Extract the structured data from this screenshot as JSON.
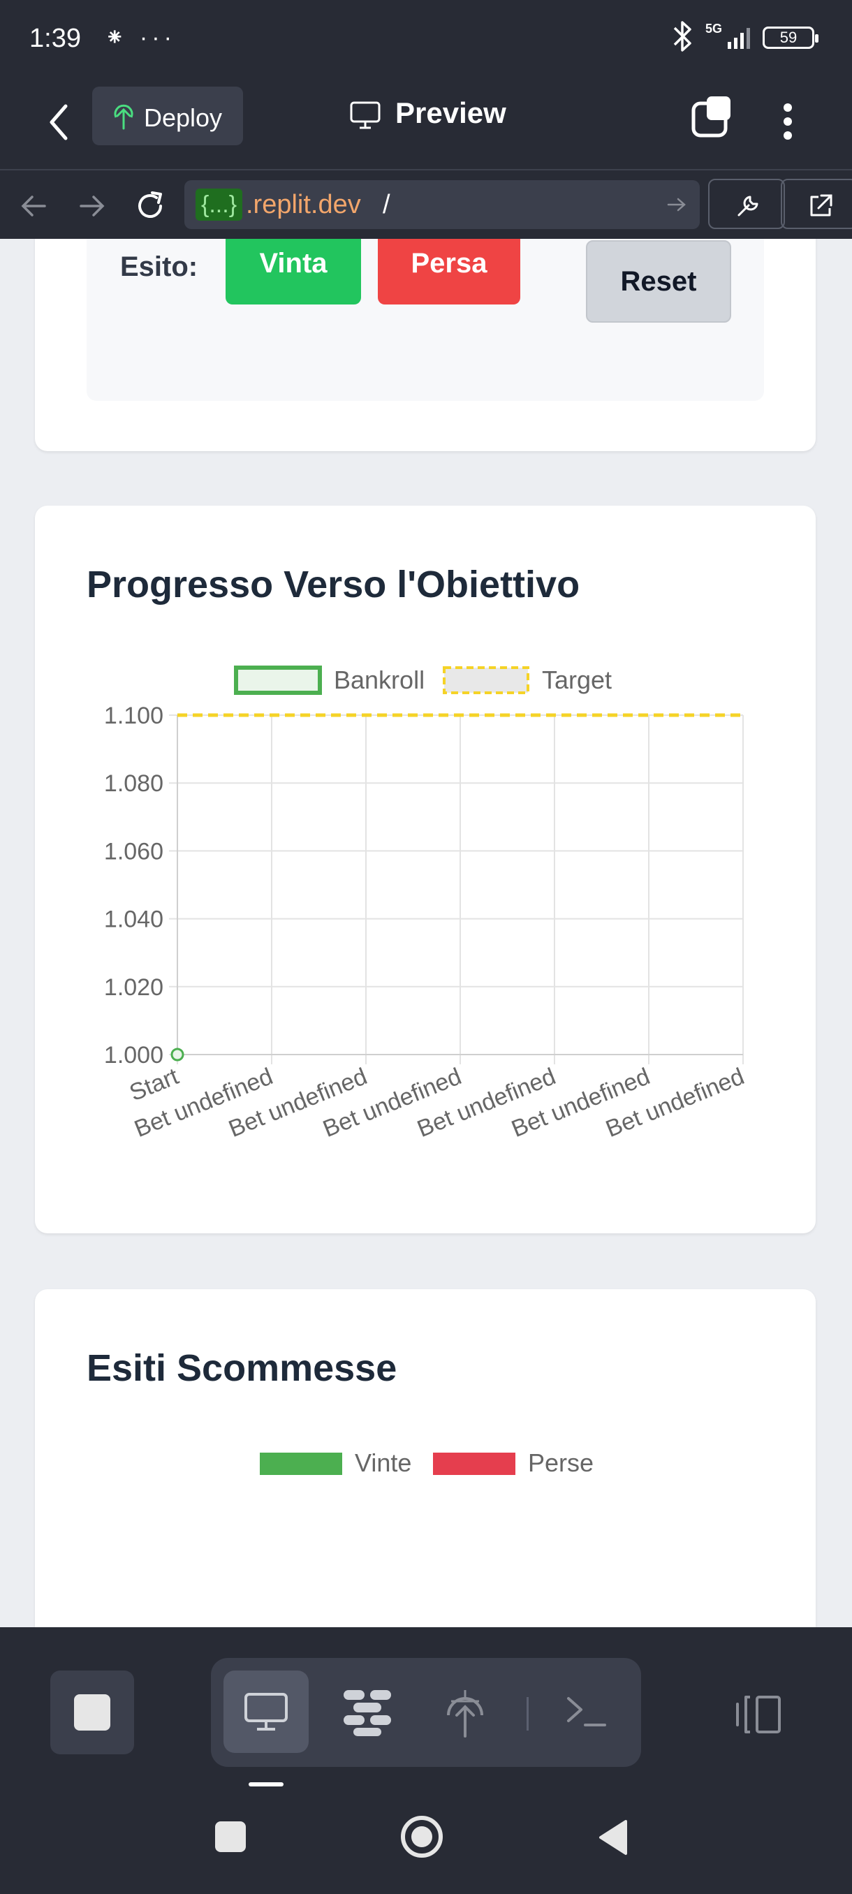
{
  "status_bar": {
    "time": "1:39",
    "left_icons": "⁕ ···",
    "network": "5G",
    "battery": "59"
  },
  "header": {
    "deploy_label": "Deploy",
    "title": "Preview"
  },
  "url_bar": {
    "badge": "{...}",
    "host": ".replit.dev",
    "path": "/"
  },
  "outcome_card": {
    "label": "Esito:",
    "win_label": "Vinta",
    "lose_label": "Persa",
    "reset_label": "Reset"
  },
  "progress_card": {
    "title": "Progresso Verso l'Obiettivo"
  },
  "chart_data": {
    "type": "line",
    "title": "",
    "xlabel": "",
    "ylabel": "",
    "categories": [
      "Start",
      "Bet undefined",
      "Bet undefined",
      "Bet undefined",
      "Bet undefined",
      "Bet undefined",
      "Bet undefined"
    ],
    "ylim": [
      1.0,
      1.1
    ],
    "y_ticks": [
      "1.000",
      "1.020",
      "1.040",
      "1.060",
      "1.080",
      "1.100"
    ],
    "grid": true,
    "legend": "top",
    "series": [
      {
        "name": "Bankroll",
        "values": [
          1.0
        ],
        "color": "#4caf50",
        "style": "solid"
      },
      {
        "name": "Target",
        "values": [
          1.1,
          1.1,
          1.1,
          1.1,
          1.1,
          1.1,
          1.1
        ],
        "color": "#f5d327",
        "style": "dashed"
      }
    ]
  },
  "results_card": {
    "title": "Esiti Scommesse",
    "legend": [
      {
        "label": "Vinte",
        "color": "#4caf50"
      },
      {
        "label": "Perse",
        "color": "#e53e4e"
      }
    ]
  }
}
